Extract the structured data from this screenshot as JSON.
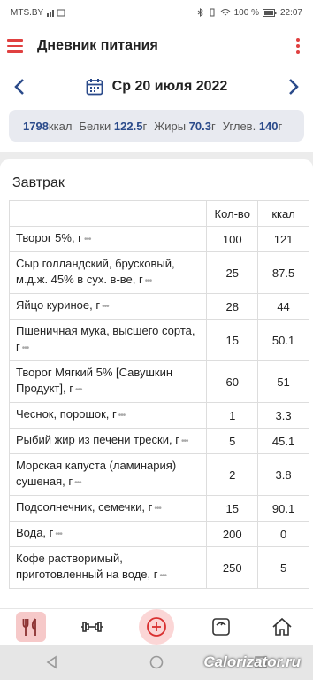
{
  "status": {
    "carrier": "MTS.BY",
    "battery": "100 %",
    "time": "22:07"
  },
  "appbar": {
    "title": "Дневник питания"
  },
  "datebar": {
    "date": "Ср 20 июля 2022"
  },
  "summary": {
    "kcal_value": "1798",
    "kcal_unit": "ккал",
    "protein_label": "Белки",
    "protein_value": "122.5",
    "protein_unit": "г",
    "fat_label": "Жиры",
    "fat_value": "70.3",
    "fat_unit": "г",
    "carb_label": "Углев.",
    "carb_value": "140",
    "carb_unit": "г"
  },
  "meal": {
    "title": "Завтрак",
    "col_qty": "Кол-во",
    "col_kcal": "ккал",
    "rows": [
      {
        "name": "Творог 5%, г",
        "qty": "100",
        "kcal": "121"
      },
      {
        "name": "Сыр голландский, брусковый, м.д.ж. 45% в сух. в-ве, г",
        "qty": "25",
        "kcal": "87.5"
      },
      {
        "name": "Яйцо куриное, г",
        "qty": "28",
        "kcal": "44"
      },
      {
        "name": "Пшеничная мука, высшего сорта, г",
        "qty": "15",
        "kcal": "50.1"
      },
      {
        "name": "Творог Мягкий 5% [Савушкин Продукт], г",
        "qty": "60",
        "kcal": "51"
      },
      {
        "name": "Чеснок, порошок, г",
        "qty": "1",
        "kcal": "3.3"
      },
      {
        "name": "Рыбий жир из печени трески, г",
        "qty": "5",
        "kcal": "45.1"
      },
      {
        "name": "Морская капуста (ламинария) сушеная, г",
        "qty": "2",
        "kcal": "3.8"
      },
      {
        "name": "Подсолнечник, семечки, г",
        "qty": "15",
        "kcal": "90.1"
      },
      {
        "name": "Вода, г",
        "qty": "200",
        "kcal": "0"
      },
      {
        "name": "Кофе растворимый, приготовленный на воде, г",
        "qty": "250",
        "kcal": "5"
      }
    ]
  },
  "nav_items": [
    "diary-icon",
    "dumbbell-icon",
    "add-icon",
    "scale-icon",
    "home-icon"
  ],
  "watermark": "Calorizator.ru",
  "colors": {
    "accent": "#e04040",
    "nav_blue": "#2a4a8a"
  }
}
